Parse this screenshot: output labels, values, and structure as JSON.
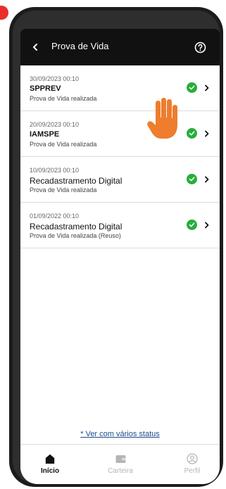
{
  "header": {
    "title": "Prova de Vida"
  },
  "items": [
    {
      "date": "30/09/2023 00:10",
      "title": "SPPREV",
      "status": "Prova de Vida realizada"
    },
    {
      "date": "20/09/2023 00:10",
      "title": "IAMSPE",
      "status": "Prova de Vida realizada"
    },
    {
      "date": "10/09/2023 00:10",
      "title": "Recadastramento Digital",
      "status": "Prova de Vida realizada"
    },
    {
      "date": "01/09/2022 00:10",
      "title": "Recadastramento Digital",
      "status": "Prova de Vida realizada (Reuso)"
    }
  ],
  "link_text": "* Ver com vários status",
  "nav": {
    "home": "Início",
    "wallet": "Carteira",
    "profile": "Perfil"
  },
  "colors": {
    "header_bg": "#111111",
    "check": "#27ae3c",
    "hand": "#ee7d2d",
    "link": "#1a4a8a",
    "marker": "#e8302b"
  },
  "icons": {
    "back": "chevron-left-icon",
    "help": "help-circle-icon",
    "status": "check-circle-icon",
    "row_action": "chevron-right-icon",
    "cursor": "hand-icon",
    "home": "home-icon",
    "wallet": "wallet-icon",
    "profile": "user-circle-icon"
  }
}
